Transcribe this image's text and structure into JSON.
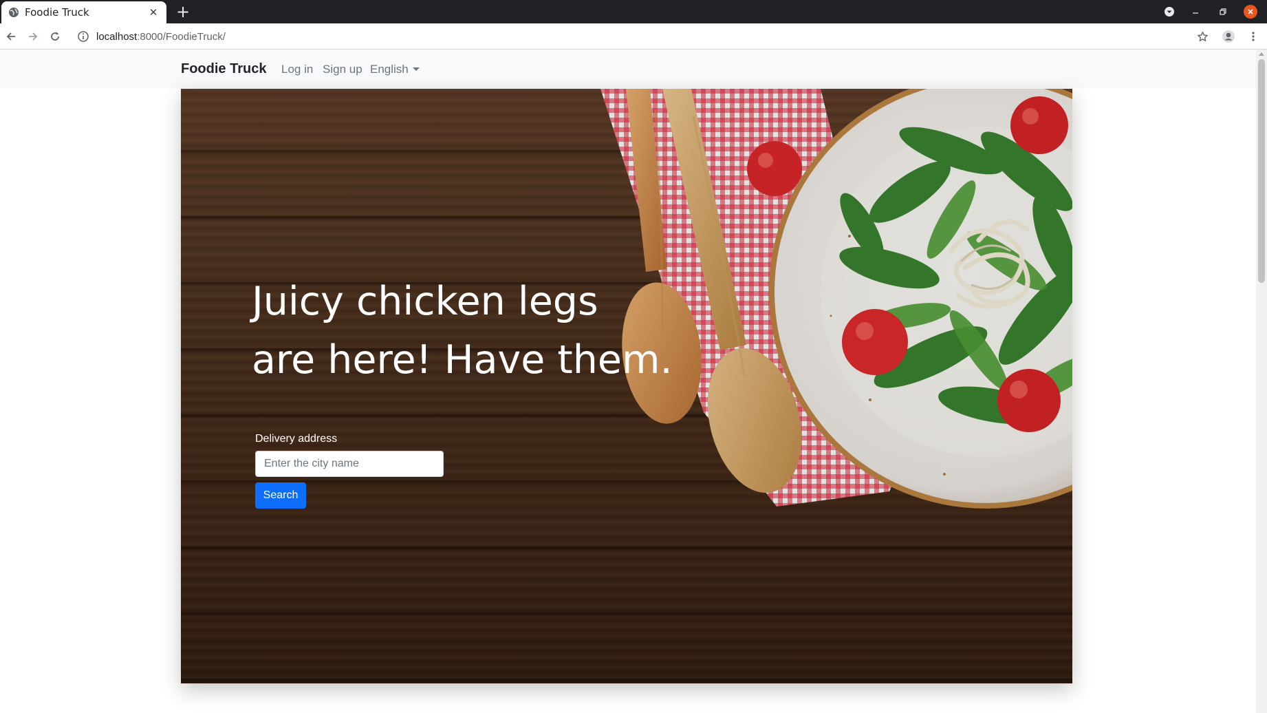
{
  "browser": {
    "tab_title": "Foodie Truck",
    "tab_close": "✕",
    "new_tab": "+",
    "url_host": "localhost",
    "url_rest": ":8000/FoodieTruck/"
  },
  "navbar": {
    "brand": "Foodie Truck",
    "login": "Log in",
    "signup": "Sign up",
    "language": "English"
  },
  "hero": {
    "headline_line1": "Juicy chicken legs",
    "headline_line2": "are here! Have them.",
    "address_label": "Delivery address",
    "city_placeholder": "Enter the city name",
    "city_value": "",
    "search_label": "Search"
  },
  "colors": {
    "primary_button": "#0d6efd",
    "navbar_bg": "#f8f9fa",
    "nav_link": "#6c757d",
    "window_close": "#e95420"
  },
  "icons": [
    "globe-icon",
    "close-icon",
    "plus-icon",
    "tab-search-icon",
    "minimize-icon",
    "restore-icon",
    "window-close-icon",
    "back-arrow-icon",
    "forward-arrow-icon",
    "reload-icon",
    "info-icon",
    "star-icon",
    "profile-icon",
    "kebab-menu-icon",
    "chevron-down-icon",
    "mouse-cursor-icon"
  ]
}
